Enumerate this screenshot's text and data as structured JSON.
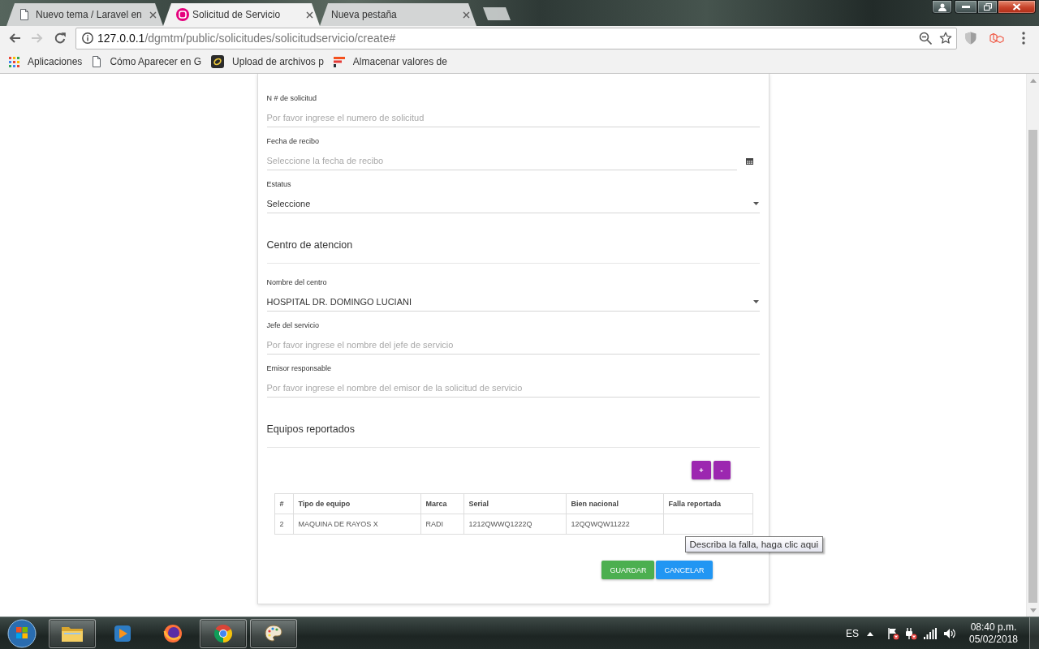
{
  "browser": {
    "tabs": [
      {
        "title": "Nuevo tema / Laravel en",
        "kind": "document",
        "selected": false
      },
      {
        "title": "Solicitud de Servicio",
        "kind": "logo",
        "selected": true
      },
      {
        "title": "Nueva pestaña",
        "kind": "blank",
        "selected": false
      }
    ],
    "navigation": [
      {
        "kind": "back",
        "disabled": false
      },
      {
        "kind": "forward",
        "disabled": true
      },
      {
        "kind": "reload",
        "disabled": false
      }
    ],
    "address": {
      "host": "127.0.0.1",
      "path": "/dgmtm/public/solicitudes/solicitudservicio/create#"
    },
    "bookmarks": [
      {
        "label": "Aplicaciones",
        "kind": "apps"
      },
      {
        "label": "Cómo Aparecer en G",
        "kind": "document"
      },
      {
        "label": "Upload de archivos p",
        "kind": "ring"
      },
      {
        "label": "Almacenar valores de",
        "kind": "bars"
      }
    ]
  },
  "form": {
    "sections": [
      {
        "fields": [
          {
            "kind": "text",
            "label": "N # de solicitud",
            "placeholder": "Por favor ingrese el numero de solicitud"
          },
          {
            "kind": "date",
            "label": "Fecha de recibo",
            "placeholder": "Seleccione la fecha de recibo"
          },
          {
            "kind": "select",
            "label": "Estatus",
            "value": "Seleccione"
          }
        ]
      },
      {
        "title": "Centro de atencion",
        "fields": [
          {
            "kind": "select",
            "label": "Nombre del centro",
            "value": "HOSPITAL DR. DOMINGO LUCIANI"
          },
          {
            "kind": "text",
            "label": "Jefe del servicio",
            "placeholder": "Por favor ingrese el nombre del jefe de servicio"
          },
          {
            "kind": "text",
            "label": "Emisor responsable",
            "placeholder": "Por favor ingrese el nombre del emisor de la solicitud de servicio"
          }
        ]
      },
      {
        "title": "Equipos reportados",
        "row_buttons": [
          "+",
          "-"
        ],
        "table": {
          "columns": [
            "#",
            "Tipo de equipo",
            "Marca",
            "Serial",
            "Bien nacional",
            "Falla reportada"
          ],
          "rows": [
            [
              "2",
              "MAQUINA DE RAYOS X",
              "RADI",
              "1212QWWQ1222Q",
              "12QQWQW11222"
            ]
          ]
        },
        "tooltip": "Describa la falla, haga clic aqui"
      }
    ],
    "actions": [
      {
        "label": "GUARDAR",
        "kind": "save"
      },
      {
        "label": "CANCELAR",
        "kind": "cancel"
      }
    ]
  },
  "taskbar": {
    "apps": [
      {
        "kind": "folder",
        "running": true
      },
      {
        "kind": "player",
        "running": false
      },
      {
        "kind": "globe",
        "running": false
      },
      {
        "kind": "wheel",
        "running": true
      },
      {
        "kind": "palette",
        "running": true
      }
    ],
    "language": "ES",
    "time": "08:40 p.m.",
    "date": "05/02/2018"
  }
}
